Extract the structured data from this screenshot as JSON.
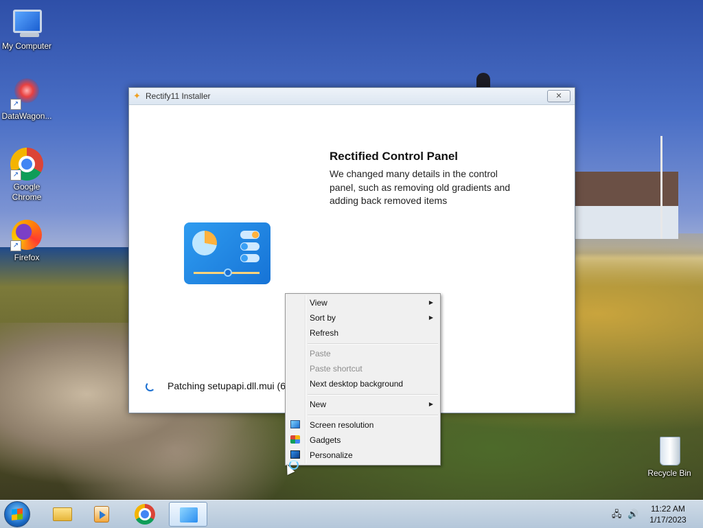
{
  "desktop": {
    "icons": [
      {
        "label": "My Computer"
      },
      {
        "label": "DataWagon..."
      },
      {
        "label": "Google Chrome"
      },
      {
        "label": "Firefox"
      },
      {
        "label": "Recycle Bin"
      }
    ]
  },
  "installer": {
    "title": "Rectify11 Installer",
    "close_glyph": "✕",
    "feature_title": "Rectified Control Panel",
    "feature_description": "We changed many details in the control panel, such as removing old gradients and adding back removed items",
    "status": "Patching setupapi.dll.mui (6"
  },
  "context_menu": {
    "items": [
      {
        "label": "View",
        "submenu": true,
        "enabled": true
      },
      {
        "label": "Sort by",
        "submenu": true,
        "enabled": true
      },
      {
        "label": "Refresh",
        "submenu": false,
        "enabled": true
      },
      {
        "label": "Paste",
        "submenu": false,
        "enabled": false
      },
      {
        "label": "Paste shortcut",
        "submenu": false,
        "enabled": false
      },
      {
        "label": "Next desktop background",
        "submenu": false,
        "enabled": true
      },
      {
        "label": "New",
        "submenu": true,
        "enabled": true
      },
      {
        "label": "Screen resolution",
        "submenu": false,
        "enabled": true,
        "icon": "screen-resolution-icon"
      },
      {
        "label": "Gadgets",
        "submenu": false,
        "enabled": true,
        "icon": "gadgets-icon"
      },
      {
        "label": "Personalize",
        "submenu": false,
        "enabled": true,
        "icon": "personalize-icon"
      }
    ],
    "submenu_glyph": "▶"
  },
  "taskbar": {
    "pinned": [
      {
        "name": "file-explorer"
      },
      {
        "name": "media-player"
      },
      {
        "name": "google-chrome"
      },
      {
        "name": "rectify11-installer",
        "active": true
      }
    ],
    "clock": {
      "time": "11:22 AM",
      "date": "1/17/2023"
    }
  },
  "colors": {
    "accent": "#1a6fd1",
    "menu_background": "#f0f0f0",
    "taskbar": "#b4c7da"
  }
}
